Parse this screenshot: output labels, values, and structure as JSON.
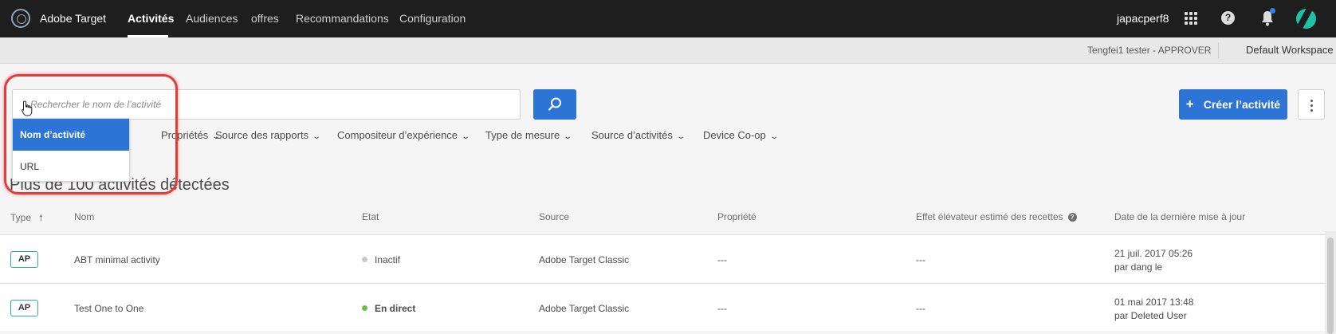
{
  "app": {
    "name": "Adobe Target"
  },
  "nav": {
    "items": [
      {
        "label": "Activités",
        "active": true
      },
      {
        "label": "Audiences"
      },
      {
        "label": "offres"
      },
      {
        "label": "Recommandations"
      },
      {
        "label": "Configuration"
      }
    ]
  },
  "header": {
    "user": "japacperf8",
    "icons": [
      "apps-grid-icon",
      "help-icon",
      "bell-icon",
      "avatar"
    ]
  },
  "subbar": {
    "approver": "Tengfei1 tester - APPROVER",
    "workspace": "Default Workspace"
  },
  "search": {
    "placeholder": "Rechercher le nom de l’activité",
    "value": "",
    "dropdown_options": [
      {
        "label": "Nom d’activité",
        "selected": true
      },
      {
        "label": "URL"
      }
    ]
  },
  "filters": [
    {
      "label": "Propriétés"
    },
    {
      "label": "Source des rapports"
    },
    {
      "label": "Compositeur d’expérience"
    },
    {
      "label": "Type de mesure"
    },
    {
      "label": "Source d’activités"
    },
    {
      "label": "Device Co-op"
    }
  ],
  "actions": {
    "create_label": "Créer l’activité",
    "create_icon": "+"
  },
  "results": {
    "count_text": "Plus de 100 activités détectées"
  },
  "table": {
    "headers": {
      "type": "Type",
      "name": "Nom",
      "state": "Etat",
      "source": "Source",
      "property": "Propriété",
      "lift": "Effet élévateur estimé des recettes",
      "updated": "Date de la dernière mise à jour"
    },
    "rows": [
      {
        "type": "AP",
        "name": "ABT minimal activity",
        "state": "Inactif",
        "state_color": "#c8c8c8",
        "live": false,
        "source": "Adobe Target Classic",
        "property": "---",
        "lift": "---",
        "updated_date": "21 juil. 2017 05:26",
        "updated_by": "par dang le"
      },
      {
        "type": "AP",
        "name": "Test One to One",
        "state": "En direct",
        "state_color": "#6cbf46",
        "live": true,
        "source": "Adobe Target Classic",
        "property": "---",
        "lift": "---",
        "updated_date": "01 mai 2017 13:48",
        "updated_by": "par Deleted User"
      }
    ]
  },
  "colors": {
    "accent": "#2c74d6",
    "topbar": "#1e1e1e",
    "highlight_ring": "#e43b3b",
    "badge_border": "#2bb1a2"
  }
}
